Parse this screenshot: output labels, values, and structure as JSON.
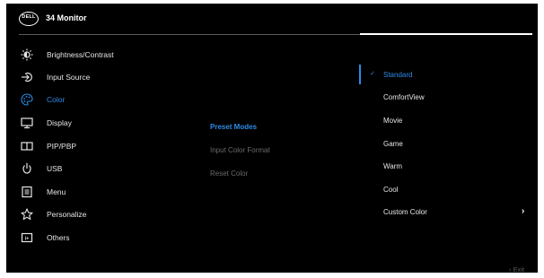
{
  "header": {
    "logo_text": "DELL",
    "title": "34 Monitor"
  },
  "menu": {
    "items": [
      {
        "id": "brightness",
        "label": "Brightness/Contrast",
        "icon": "sun-icon"
      },
      {
        "id": "input",
        "label": "Input Source",
        "icon": "input-source-icon"
      },
      {
        "id": "color",
        "label": "Color",
        "icon": "palette-icon",
        "active": true
      },
      {
        "id": "display",
        "label": "Display",
        "icon": "monitor-icon"
      },
      {
        "id": "pip",
        "label": "PIP/PBP",
        "icon": "pip-pbp-icon"
      },
      {
        "id": "usb",
        "label": "USB",
        "icon": "usb-icon"
      },
      {
        "id": "menu",
        "label": "Menu",
        "icon": "menu-icon"
      },
      {
        "id": "personalize",
        "label": "Personalize",
        "icon": "star-icon"
      },
      {
        "id": "others",
        "label": "Others",
        "icon": "others-icon"
      }
    ]
  },
  "submenu": {
    "items": [
      {
        "label": "Preset Modes",
        "active": true
      },
      {
        "label": "Input Color Format",
        "active": false
      },
      {
        "label": "Reset Color",
        "active": false
      }
    ]
  },
  "options": {
    "items": [
      {
        "label": "Standard",
        "selected": true
      },
      {
        "label": "ComfortView"
      },
      {
        "label": "Movie"
      },
      {
        "label": "Game"
      },
      {
        "label": "Warm"
      },
      {
        "label": "Cool"
      },
      {
        "label": "Custom Color",
        "has_submenu": true
      }
    ],
    "check_glyph": "✓",
    "arrow_glyph": "›"
  },
  "footer": {
    "exit_label": "‹  Exit"
  },
  "colors": {
    "accent": "#2e8be6",
    "background": "#000000",
    "text": "#e6e6e6",
    "muted": "#6a6a6a"
  }
}
